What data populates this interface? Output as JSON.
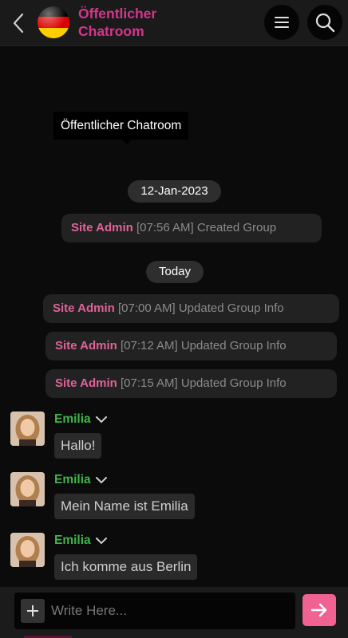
{
  "header": {
    "title_line1": "Öffentlicher",
    "title_line2": "Chatroom",
    "flag_colors": [
      "#000000",
      "#dd0000",
      "#ffce00"
    ],
    "accent_color": "#d6358d"
  },
  "tooltip": {
    "text": "Öffentlicher Chatroom"
  },
  "separators": {
    "date": "12-Jan-2023",
    "today": "Today"
  },
  "system_messages": [
    {
      "who": "Site Admin",
      "what": "[07:56 AM] Created Group"
    },
    {
      "who": "Site Admin",
      "what": "[07:00 AM] Updated Group Info"
    },
    {
      "who": "Site Admin",
      "what": "[07:12 AM] Updated Group Info"
    },
    {
      "who": "Site Admin",
      "what": "[07:15 AM] Updated Group Info"
    }
  ],
  "messages": [
    {
      "sender": "Emilia",
      "text": "Hallo!"
    },
    {
      "sender": "Emilia",
      "text": "Mein Name ist Emilia"
    },
    {
      "sender": "Emilia",
      "text": "Ich komme aus Berlin"
    }
  ],
  "composer": {
    "placeholder": "Write Here...",
    "send_color": "#f06292"
  }
}
